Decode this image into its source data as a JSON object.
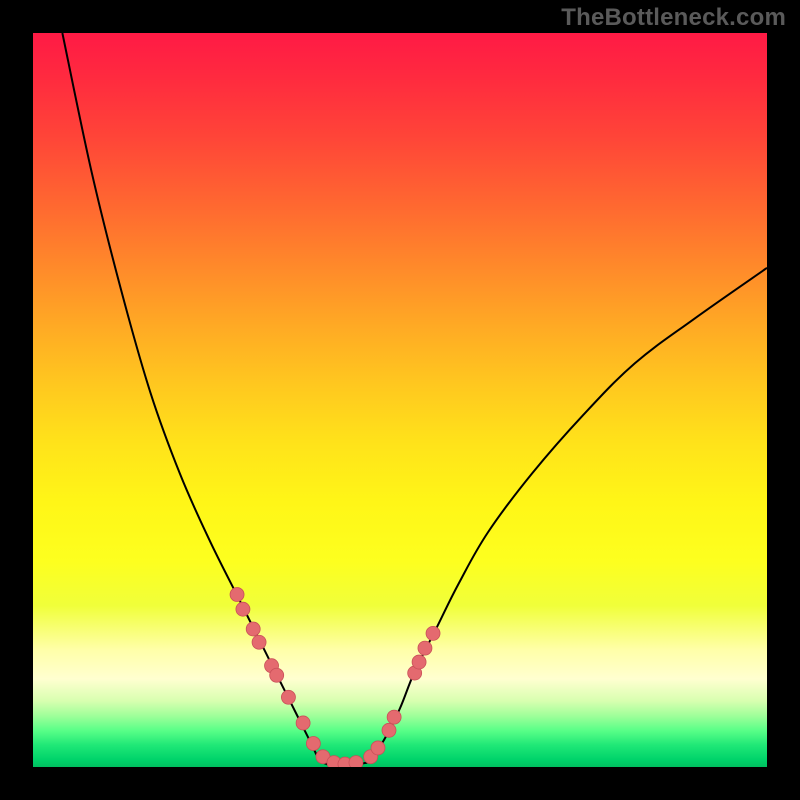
{
  "attribution": "TheBottleneck.com",
  "colors": {
    "frame": "#000000",
    "dot_fill": "#e46a6f",
    "dot_stroke": "#c95058",
    "curve": "#000000"
  },
  "chart_data": {
    "type": "line",
    "title": "",
    "xlabel": "",
    "ylabel": "",
    "xlim": [
      0,
      100
    ],
    "ylim": [
      0,
      100
    ],
    "grid": false,
    "legend": false,
    "series": [
      {
        "name": "bottleneck-curve-left",
        "x": [
          4,
          8,
          12,
          16,
          20,
          24,
          28,
          30,
          32,
          34,
          36,
          38,
          39
        ],
        "y": [
          100,
          81,
          65,
          51,
          40,
          31,
          23,
          19,
          15,
          11,
          7,
          3,
          1
        ]
      },
      {
        "name": "bottleneck-curve-right",
        "x": [
          46,
          48,
          50,
          52,
          55,
          58,
          62,
          68,
          75,
          82,
          90,
          100
        ],
        "y": [
          1,
          4,
          8,
          13,
          19,
          25,
          32,
          40,
          48,
          55,
          61,
          68
        ]
      },
      {
        "name": "bottleneck-floor",
        "x": [
          39,
          40,
          41,
          42,
          43,
          44,
          45,
          46
        ],
        "y": [
          1,
          0.4,
          0.2,
          0.2,
          0.2,
          0.3,
          0.5,
          1
        ]
      }
    ],
    "scatter": {
      "name": "highlighted-points",
      "x": [
        27.8,
        28.6,
        30.0,
        30.8,
        32.5,
        33.2,
        34.8,
        36.8,
        38.2,
        39.5,
        41.0,
        42.5,
        44.0,
        46.0,
        47.0,
        48.5,
        49.2,
        52.0,
        52.6,
        53.4,
        54.5
      ],
      "y": [
        23.5,
        21.5,
        18.8,
        17.0,
        13.8,
        12.5,
        9.5,
        6.0,
        3.2,
        1.4,
        0.6,
        0.4,
        0.6,
        1.4,
        2.6,
        5.0,
        6.8,
        12.8,
        14.3,
        16.2,
        18.2
      ]
    },
    "dot_radius_px": 7
  }
}
